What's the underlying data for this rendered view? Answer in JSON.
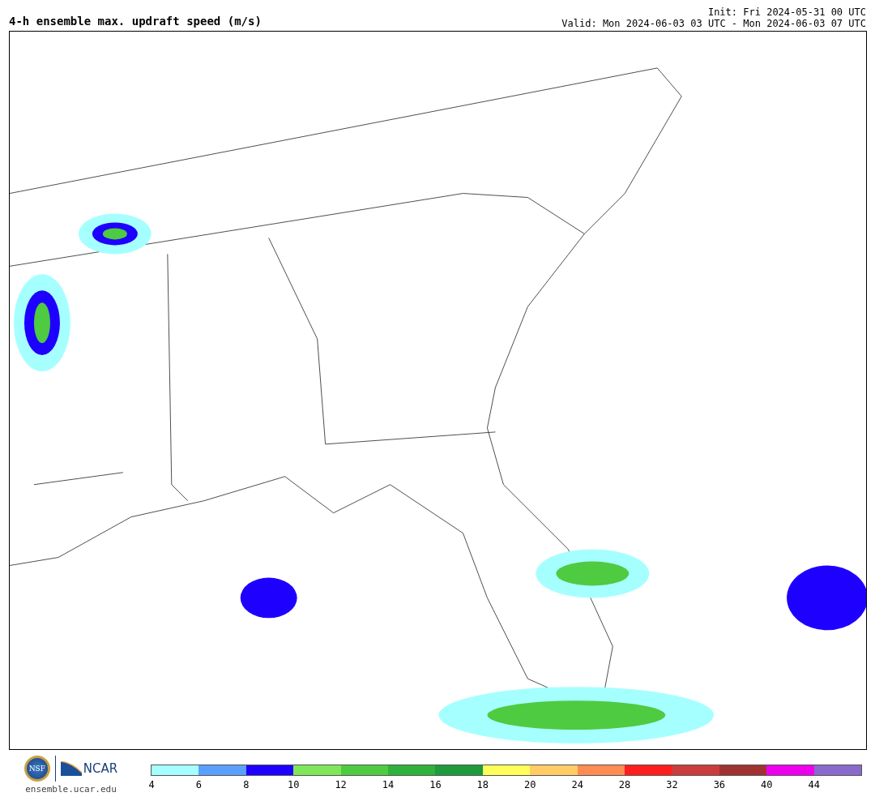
{
  "title": "4-h ensemble max. updraft speed (m/s)",
  "init": "Init: Fri 2024-05-31 00 UTC",
  "valid": "Valid: Mon 2024-06-03 03 UTC - Mon 2024-06-03 07 UTC",
  "logos": {
    "nsf": "NSF",
    "ncar": "NCAR",
    "site": "ensemble.ucar.edu"
  },
  "colorbar": {
    "bins": [
      {
        "color": "#a6ffff",
        "label": "4"
      },
      {
        "color": "#5aa0ff",
        "label": "6"
      },
      {
        "color": "#1e00ff",
        "label": "8"
      },
      {
        "color": "#80e65a",
        "label": "10"
      },
      {
        "color": "#4ecb40",
        "label": "12"
      },
      {
        "color": "#2eb23b",
        "label": "14"
      },
      {
        "color": "#1f9a3c",
        "label": "16"
      },
      {
        "color": "#ffff5a",
        "label": "18"
      },
      {
        "color": "#ffcc66",
        "label": "20"
      },
      {
        "color": "#ff8c50",
        "label": "24"
      },
      {
        "color": "#ff1e1e",
        "label": "28"
      },
      {
        "color": "#cc3c3c",
        "label": "32"
      },
      {
        "color": "#a03232",
        "label": "36"
      },
      {
        "color": "#ee00ee",
        "label": "40"
      },
      {
        "color": "#8a6acc",
        "label": "44"
      }
    ]
  }
}
